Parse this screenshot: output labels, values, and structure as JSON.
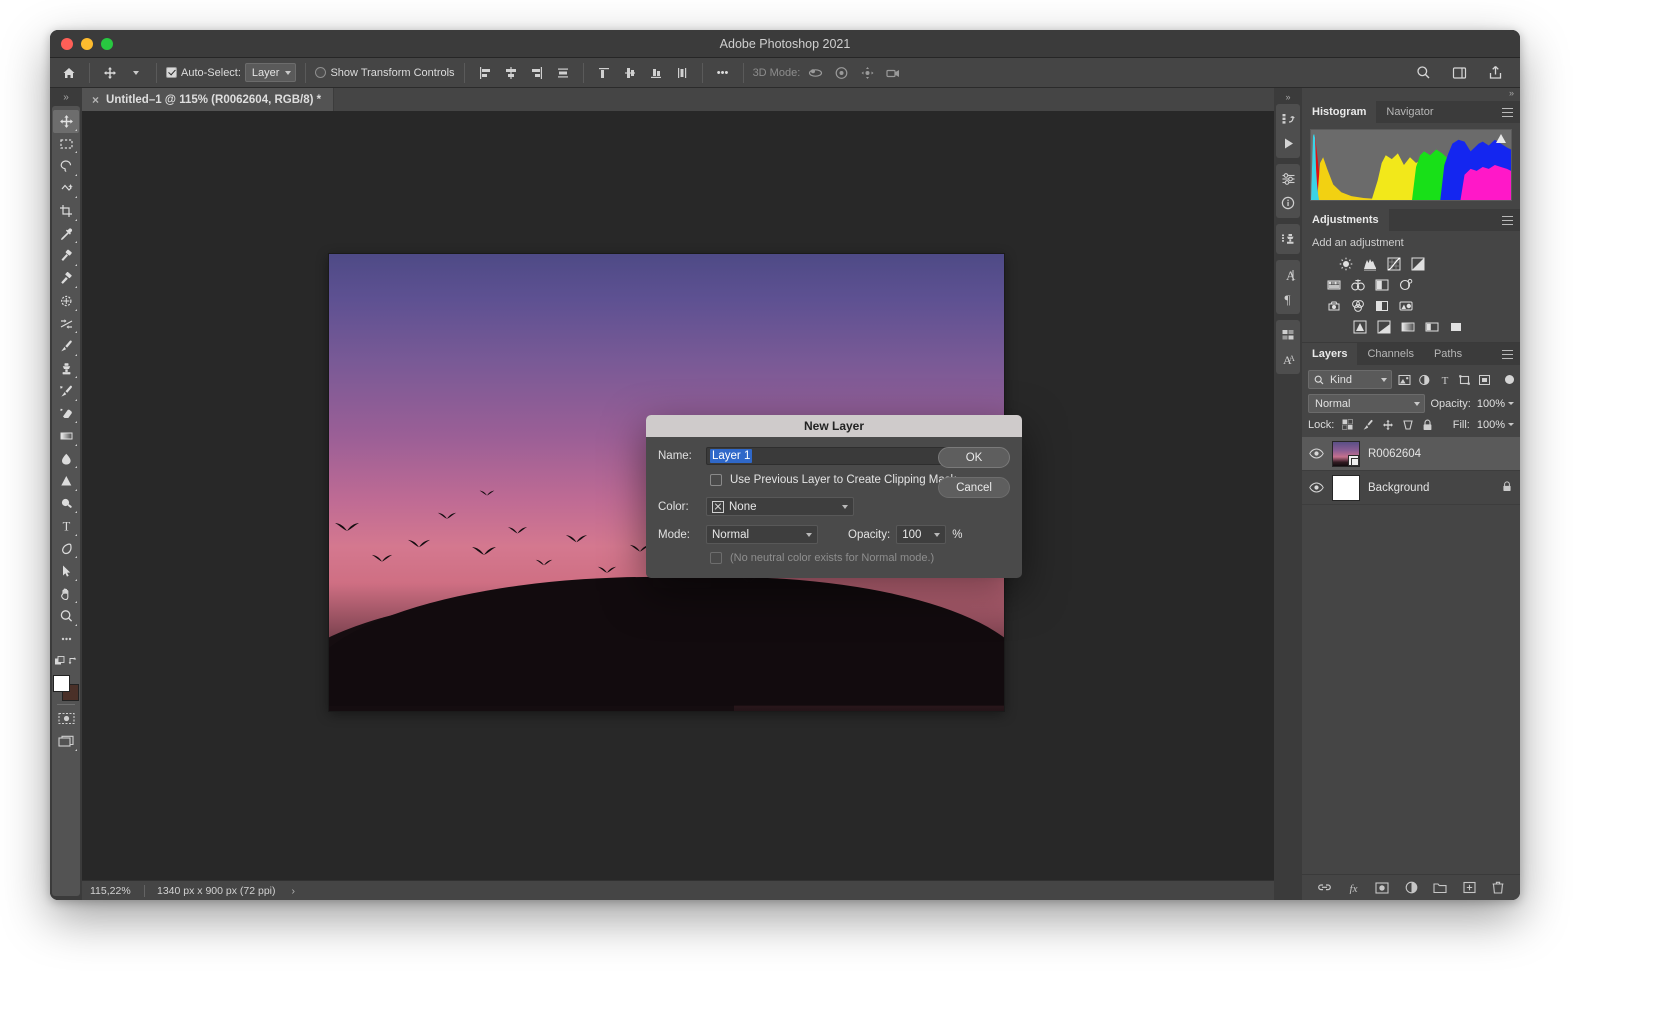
{
  "window": {
    "title": "Adobe Photoshop 2021",
    "traffic_lights": [
      "close",
      "minimize",
      "zoom"
    ]
  },
  "options_bar": {
    "home_icon": "home-icon",
    "move_tool_icon": "move-tool-icon",
    "auto_select_checked": true,
    "auto_select_label": "Auto-Select:",
    "auto_select_value": "Layer",
    "show_transform_label": "Show Transform Controls",
    "show_transform_checked": false,
    "align_icons": [
      "align-left-edges",
      "align-horizontal-centers",
      "align-right-edges",
      "distribute-horizontally"
    ],
    "distribute_icons": [
      "align-top-edges",
      "align-vertical-centers",
      "align-bottom-edges",
      "distribute-vertically"
    ],
    "more_label": "•••",
    "three_d_mode_label": "3D Mode:",
    "three_d_icons": [
      "orbit-3d",
      "roll-3d",
      "pan-3d",
      "slide-3d"
    ],
    "right_icons": [
      "search-icon",
      "workspace-icon",
      "share-icon"
    ]
  },
  "toolbar": {
    "tools": [
      {
        "name": "move-tool",
        "active": true
      },
      {
        "name": "rectangular-marquee-tool",
        "active": false
      },
      {
        "name": "lasso-tool",
        "active": false
      },
      {
        "name": "object-selection-tool",
        "active": false
      },
      {
        "name": "crop-tool",
        "active": false
      },
      {
        "name": "eyedropper-tool",
        "active": false
      },
      {
        "name": "spot-healing-brush-tool",
        "active": false
      },
      {
        "name": "brush-tool",
        "active": false
      },
      {
        "name": "clone-stamp-tool",
        "active": false
      },
      {
        "name": "history-brush-tool",
        "active": false
      },
      {
        "name": "eraser-tool",
        "active": false
      },
      {
        "name": "gradient-tool",
        "active": false
      },
      {
        "name": "blur-tool",
        "active": false
      },
      {
        "name": "dodge-tool",
        "active": false
      },
      {
        "name": "pen-tool",
        "active": false
      },
      {
        "name": "type-tool",
        "active": false
      },
      {
        "name": "path-selection-tool",
        "active": false
      },
      {
        "name": "direct-selection-tool",
        "active": false
      },
      {
        "name": "hand-tool",
        "active": false
      },
      {
        "name": "zoom-tool",
        "active": false
      },
      {
        "name": "edit-toolbar-tool",
        "active": false
      }
    ],
    "foreground_color": "#ffffff",
    "background_color": "#4a3028",
    "quick_mask_icon": "quick-mask-icon",
    "screen_mode_icon": "screen-mode-icon"
  },
  "document_tab": {
    "close_label": "×",
    "title": "Untitled–1 @ 115% (R0062604, RGB/8) *"
  },
  "status_bar": {
    "zoom": "115,22%",
    "dimensions": "1340 px x 900 px (72 ppi)",
    "arrow": "›"
  },
  "right_rail": {
    "buttons": [
      "history-states-icon",
      "play-action-icon",
      "adjustments-icon",
      "info-icon",
      "clone-source-icon",
      "character-icon",
      "paragraph-icon",
      "styles-icon",
      "glyphs-icon"
    ]
  },
  "panels": {
    "histogram": {
      "tabs": [
        {
          "label": "Histogram",
          "active": true
        },
        {
          "label": "Navigator",
          "active": false
        }
      ],
      "warning_icon": "uncached-data-warning-icon"
    },
    "adjustments": {
      "tabs": [
        {
          "label": "Adjustments",
          "active": true
        }
      ],
      "subtitle": "Add an adjustment",
      "icons_row1": [
        "brightness-contrast-icon",
        "levels-icon",
        "curves-icon",
        "exposure-icon"
      ],
      "icons_row2": [
        "vibrance-icon",
        "hue-saturation-icon",
        "color-balance-icon",
        "black-white-icon",
        "photo-filter-icon",
        "channel-mixer-icon"
      ],
      "icons_row3": [
        "color-lookup-icon",
        "invert-icon",
        "posterize-icon",
        "threshold-icon",
        "gradient-map-icon",
        "selective-color-icon"
      ]
    },
    "layers": {
      "tabs": [
        {
          "label": "Layers",
          "active": true
        },
        {
          "label": "Channels",
          "active": false
        },
        {
          "label": "Paths",
          "active": false
        }
      ],
      "filter_kind_label": "Kind",
      "filter_icons": [
        "filter-pixel-icon",
        "filter-adjustment-icon",
        "filter-type-icon",
        "filter-shape-icon",
        "filter-smart-object-icon"
      ],
      "blend_mode": "Normal",
      "opacity_label": "Opacity:",
      "opacity_value": "100%",
      "lock_label": "Lock:",
      "lock_icons": [
        "lock-transparent-pixels-icon",
        "lock-image-pixels-icon",
        "lock-position-icon",
        "lock-artboard-nesting-icon",
        "lock-all-icon"
      ],
      "fill_label": "Fill:",
      "fill_value": "100%",
      "items": [
        {
          "name": "R0062604",
          "visible": true,
          "selected": true,
          "kind": "smart-object",
          "locked": false
        },
        {
          "name": "Background",
          "visible": true,
          "selected": false,
          "kind": "raster",
          "locked": true
        }
      ],
      "footer_icons": [
        "link-layers-icon",
        "layer-style-icon",
        "add-layer-mask-icon",
        "new-fill-adjustment-icon",
        "new-group-icon",
        "new-layer-icon",
        "delete-layer-icon"
      ]
    }
  },
  "dialog": {
    "title": "New Layer",
    "name_label": "Name:",
    "name_value": "Layer 1",
    "ok_label": "OK",
    "cancel_label": "Cancel",
    "clipping_checkbox_checked": false,
    "clipping_label": "Use Previous Layer to Create Clipping Mask",
    "color_label": "Color:",
    "color_value": "None",
    "mode_label": "Mode:",
    "mode_value": "Normal",
    "opacity_label": "Opacity:",
    "opacity_value": "100",
    "percent_symbol": "%",
    "note": "(No neutral color exists for Normal mode.)"
  },
  "colors": {
    "selection_blue": "#2f68c9",
    "panel_bg": "#454545",
    "window_bg": "#323232",
    "canvas_bg": "#282828"
  }
}
